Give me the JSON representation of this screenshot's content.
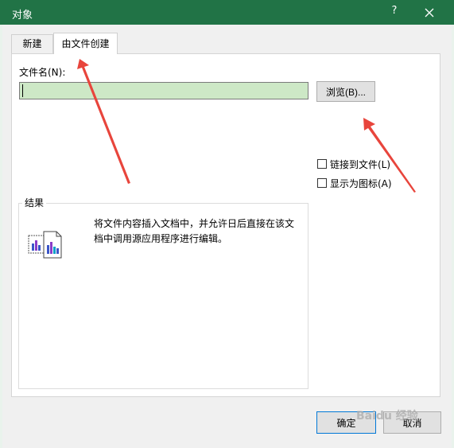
{
  "window": {
    "title": "对象",
    "help_label": "?",
    "close_icon": "close-icon"
  },
  "tabs": [
    {
      "label": "新建",
      "active": false
    },
    {
      "label": "由文件创建",
      "active": true
    }
  ],
  "file": {
    "label": "文件名(N):",
    "value": "",
    "browse_label": "浏览(B)..."
  },
  "options": [
    {
      "label": "链接到文件(L)",
      "checked": false
    },
    {
      "label": "显示为图标(A)",
      "checked": false
    }
  ],
  "result": {
    "title": "结果",
    "description": "将文件内容插入文档中，并允许日后直接在该文档中调用源应用程序进行编辑。",
    "icon": "embedded-document-icon"
  },
  "footer": {
    "ok_label": "确定",
    "cancel_label": "取消"
  },
  "watermark": "Baidu 经验",
  "colors": {
    "titlebar": "#217346",
    "input_fill": "#cde8c6",
    "annotation_arrow": "#e8453c"
  }
}
